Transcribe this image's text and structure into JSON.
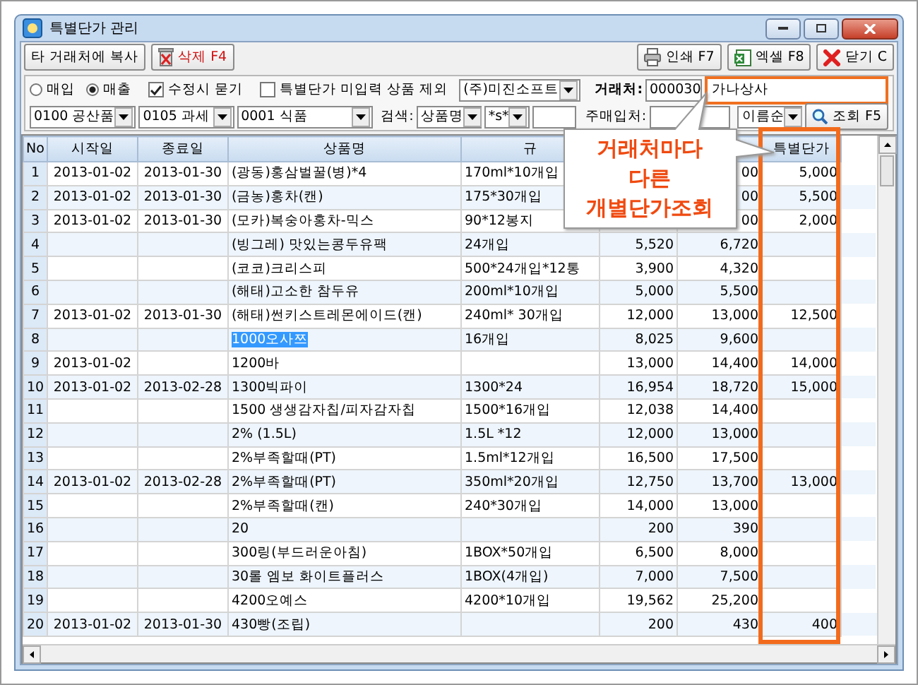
{
  "window": {
    "title": "특별단가 관리"
  },
  "toolbar": {
    "left": [
      {
        "kind": "copy",
        "label": "타 거래처에 복사"
      },
      {
        "kind": "delete",
        "label": "삭제 F4"
      }
    ],
    "right": [
      {
        "kind": "print",
        "label": "인쇄 F7"
      },
      {
        "kind": "excel",
        "label": "엑셀 F8"
      },
      {
        "kind": "close",
        "label": "닫기 C"
      }
    ]
  },
  "filters": {
    "radios": [
      {
        "label": "매입",
        "selected": false
      },
      {
        "label": "매출",
        "selected": true
      }
    ],
    "checkboxes": [
      {
        "label": "수정시 묻기",
        "checked": true
      },
      {
        "label": "특별단가 미입력 상품 제외",
        "checked": false
      }
    ],
    "company": "(주)미진소프트",
    "client_label": "거래처:",
    "client_code": "000030",
    "client_name": "가나상사",
    "category_1": "0100 공산품",
    "category_2": "0105 과세",
    "category_3": "0001 식품",
    "search_label": "검색:",
    "search_field": "상품명",
    "search_mode": "*s*",
    "supplier_label": "주매입처:",
    "sort": "이름순",
    "query_button": "조회 F5"
  },
  "table": {
    "columns": [
      "No",
      "시작일",
      "종료일",
      "상품명",
      "규",
      null,
      null,
      "특별단가"
    ],
    "rows": [
      {
        "selected": false,
        "cells": [
          "1",
          "2013-01-02",
          "2013-01-30",
          "(광동)홍삼벌꿀(병)*4",
          "170ml*10개입",
          null,
          "00",
          "5,000"
        ]
      },
      {
        "selected": false,
        "cells": [
          "2",
          "2013-01-02",
          "2013-01-30",
          "(금농)홍차(캔)",
          "175*30개입",
          null,
          "00",
          "5,500"
        ]
      },
      {
        "selected": false,
        "cells": [
          "3",
          "2013-01-02",
          "2013-01-30",
          "(모카)복숭아홍차-믹스",
          "90*12봉지",
          null,
          "00",
          "2,000"
        ]
      },
      {
        "selected": false,
        "cells": [
          "4",
          null,
          null,
          "(빙그레) 맛있는콩두유팩",
          "24개입",
          "5,520",
          "6,720",
          null
        ]
      },
      {
        "selected": false,
        "cells": [
          "5",
          null,
          null,
          "(코코)크리스피",
          "500*24개입*12통",
          "3,900",
          "4,320",
          null
        ]
      },
      {
        "selected": false,
        "cells": [
          "6",
          null,
          null,
          "(해태)고소한 참두유",
          "200ml*10개입",
          "5,000",
          "5,500",
          null
        ]
      },
      {
        "selected": false,
        "cells": [
          "7",
          "2013-01-02",
          "2013-01-30",
          "(해태)썬키스트레몬에이드(캔)",
          "240ml* 30개입",
          "12,000",
          "13,000",
          "12,500"
        ]
      },
      {
        "selected": true,
        "cells": [
          "8",
          null,
          null,
          "1000오사쯔",
          "16개입",
          "8,025",
          "9,600",
          null
        ]
      },
      {
        "selected": false,
        "cells": [
          "9",
          "2013-01-02",
          null,
          "1200바",
          null,
          "13,000",
          "14,400",
          "14,000"
        ]
      },
      {
        "selected": false,
        "cells": [
          "10",
          "2013-01-02",
          "2013-02-28",
          "1300빅파이",
          "1300*24",
          "16,954",
          "18,720",
          "15,000"
        ]
      },
      {
        "selected": false,
        "cells": [
          "11",
          null,
          null,
          "1500 생생감자칩/피자감자칩",
          "1500*16개입",
          "12,038",
          "14,400",
          null
        ]
      },
      {
        "selected": false,
        "cells": [
          "12",
          null,
          null,
          "2% (1.5L)",
          "1.5L *12",
          "12,000",
          "13,000",
          null
        ]
      },
      {
        "selected": false,
        "cells": [
          "13",
          null,
          null,
          "2%부족할때(PT)",
          "1.5ml*12개입",
          "16,500",
          "17,500",
          null
        ]
      },
      {
        "selected": false,
        "cells": [
          "14",
          "2013-01-02",
          "2013-02-28",
          "2%부족할때(PT)",
          "350ml*20개입",
          "12,750",
          "13,700",
          "13,000"
        ]
      },
      {
        "selected": false,
        "cells": [
          "15",
          null,
          null,
          "2%부족할때(캔)",
          "240*30개입",
          "14,000",
          "13,000",
          null
        ]
      },
      {
        "selected": false,
        "cells": [
          "16",
          null,
          null,
          "20",
          null,
          "200",
          "390",
          null
        ]
      },
      {
        "selected": false,
        "cells": [
          "17",
          null,
          null,
          "300링(부드러운아침)",
          "1BOX*50개입",
          "6,500",
          "8,000",
          null
        ]
      },
      {
        "selected": false,
        "cells": [
          "18",
          null,
          null,
          "30롤 엠보 화이트플러스",
          "1BOX(4개입)",
          "7,000",
          "7,500",
          null
        ]
      },
      {
        "selected": false,
        "cells": [
          "19",
          null,
          null,
          "4200오예스",
          "4200*10개입",
          "19,562",
          "25,200",
          null
        ]
      },
      {
        "selected": false,
        "cells": [
          "20",
          "2013-01-02",
          "2013-01-30",
          "430빵(조립)",
          null,
          "200",
          "430",
          "400"
        ]
      }
    ]
  },
  "callout": {
    "text": "거래처마다\n다른\n개별단가조회"
  }
}
